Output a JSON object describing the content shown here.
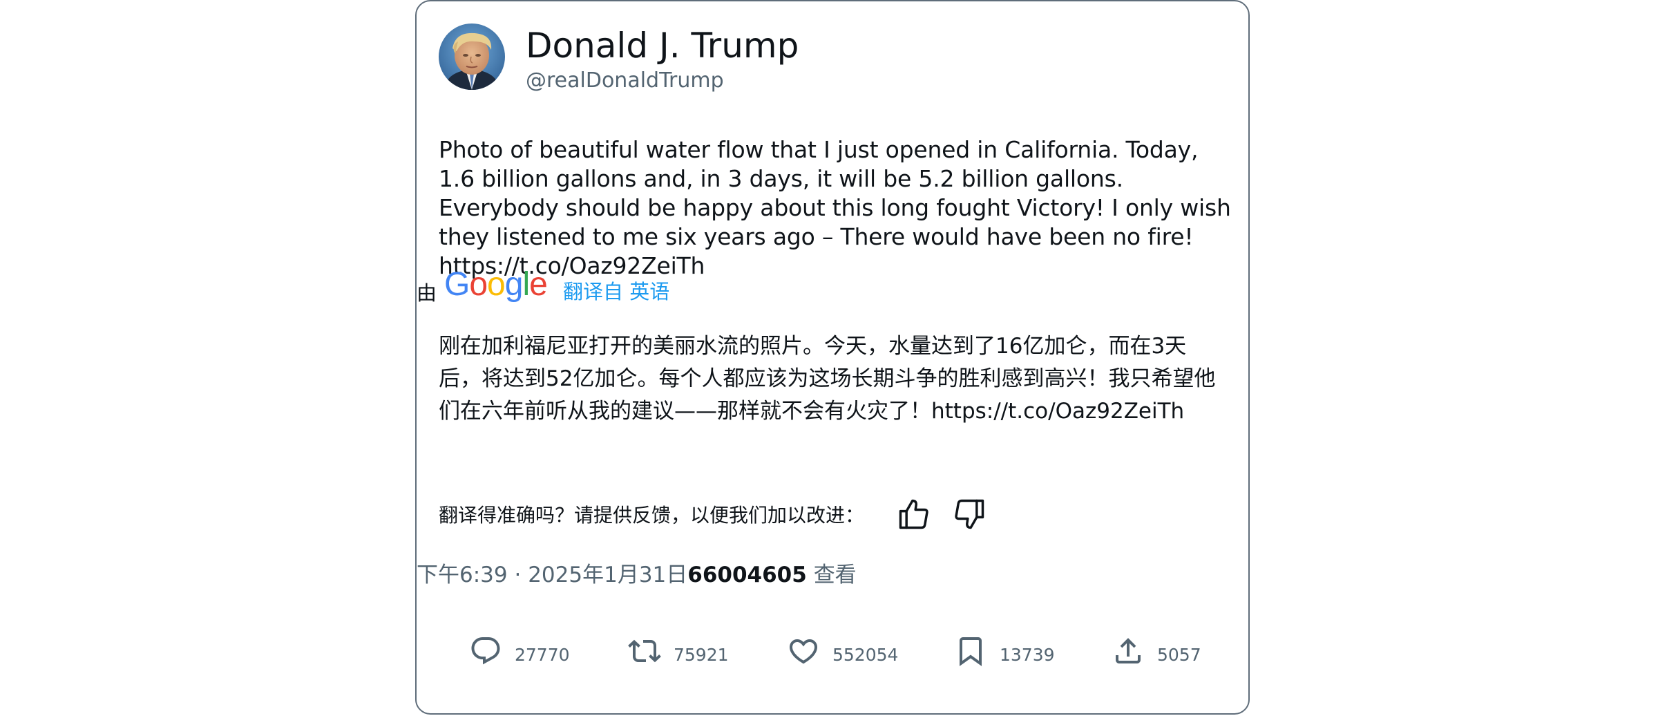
{
  "author": {
    "display_name": "Donald J. Trump",
    "handle": "@realDonaldTrump"
  },
  "tweet": {
    "text": "Photo of beautiful water flow that I just opened in California. Today, 1.6 billion gallons and, in 3 days, it will be 5.2 billion gallons. Everybody should be happy about this long fought Victory! I only wish they listened to me six years ago – There would have been no fire! https://t.co/Oaz92ZeiTh"
  },
  "translation": {
    "by_label": "由",
    "provider_logo": "Google",
    "link_label": "翻译自 英语",
    "text": "刚在加利福尼亚打开的美丽水流的照片。今天，水量达到了16亿加仑，而在3天后，将达到52亿加仑。每个人都应该为这场长期斗争的胜利感到高兴！我只希望他们在六年前听从我的建议——那样就不会有火灾了！https://t.co/Oaz92ZeiTh",
    "feedback_prompt": "翻译得准确吗？请提供反馈，以便我们加以改进：",
    "thumbs_up_icon": "thumbs-up-icon",
    "thumbs_down_icon": "thumbs-down-icon"
  },
  "meta": {
    "time": "下午6:39",
    "separator": "·",
    "date": "2025年1月31日",
    "views": "66004605",
    "views_label": "查看"
  },
  "actions": {
    "reply": {
      "icon": "reply-icon",
      "count": "27770"
    },
    "retweet": {
      "icon": "retweet-icon",
      "count": "75921"
    },
    "like": {
      "icon": "heart-icon",
      "count": "552054"
    },
    "bookmark": {
      "icon": "bookmark-icon",
      "count": "13739"
    },
    "share": {
      "icon": "share-icon",
      "count": "5057"
    }
  },
  "colors": {
    "text_primary": "#0f1419",
    "text_secondary": "#536471",
    "link": "#1d9bf0",
    "border": "#5f6d7a"
  }
}
